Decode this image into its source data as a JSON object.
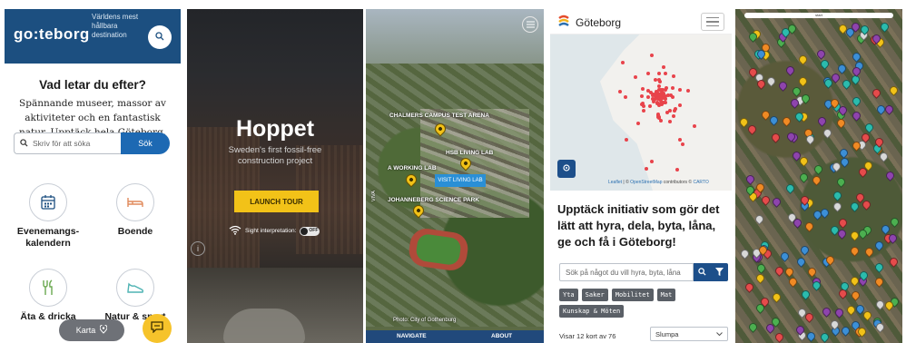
{
  "panel1": {
    "logo": "go:teborg",
    "tagline": "Världens mest hållbara destination",
    "question": "Vad letar du efter?",
    "intro": "Spännande museer, massor av aktiviteter och en fantastisk natur. Upptäck hela Göteborg.",
    "search_placeholder": "Skriv för att söka",
    "search_button": "Sök",
    "categories": [
      "Evenemangs-\nkalendern",
      "Boende",
      "Äta & dricka",
      "Natur & sport"
    ],
    "map_button": "Karta",
    "colors": {
      "header": "#1c4f80",
      "button": "#1d69b3",
      "chat": "#f6c32b"
    }
  },
  "panel2": {
    "title": "Hoppet",
    "subtitle": "Sweden's first fossil-free construction project",
    "tour_button": "LAUNCH TOUR",
    "sight_label": "Sight interpretation:",
    "toggle_state": "OFF",
    "accent": "#f2c218"
  },
  "panel3": {
    "labels": {
      "chalmers": "CHALMERS CAMPUS TEST ARENA",
      "livinglab": "HSB LIVING LAB",
      "workinglab": "A WORKING LAB",
      "johanneberg": "JOHANNEBERG SCIENCE PARK"
    },
    "visit_button": "VISIT LIVING LAB",
    "photo_credit": "Photo: City of Gothenburg",
    "vertical_text": "VIVA",
    "nav": {
      "navigate": "NAVIGATE",
      "about": "ABOUT"
    }
  },
  "panel4": {
    "brand": "Göteborg",
    "attribution_leaflet": "Leaflet",
    "attribution_osm": "OpenStreetMap",
    "attribution_rest": "contributors ©",
    "attribution_carto": "CARTO",
    "heading": "Upptäck initiativ som gör det lätt att hyra, dela, byta, låna, ge och få i Göteborg!",
    "search_placeholder": "Sök på något du vill hyra, byta, låna",
    "tags": [
      "Yta",
      "Saker",
      "Mobilitet",
      "Mat",
      "Kunskap & Möten"
    ],
    "result_count": "Visar 12 kort av 76",
    "sort_value": "Slumpa",
    "colors": {
      "dots": "#e8434b",
      "button": "#1d4f8a"
    }
  },
  "panel5": {
    "topbar_text": "start"
  }
}
